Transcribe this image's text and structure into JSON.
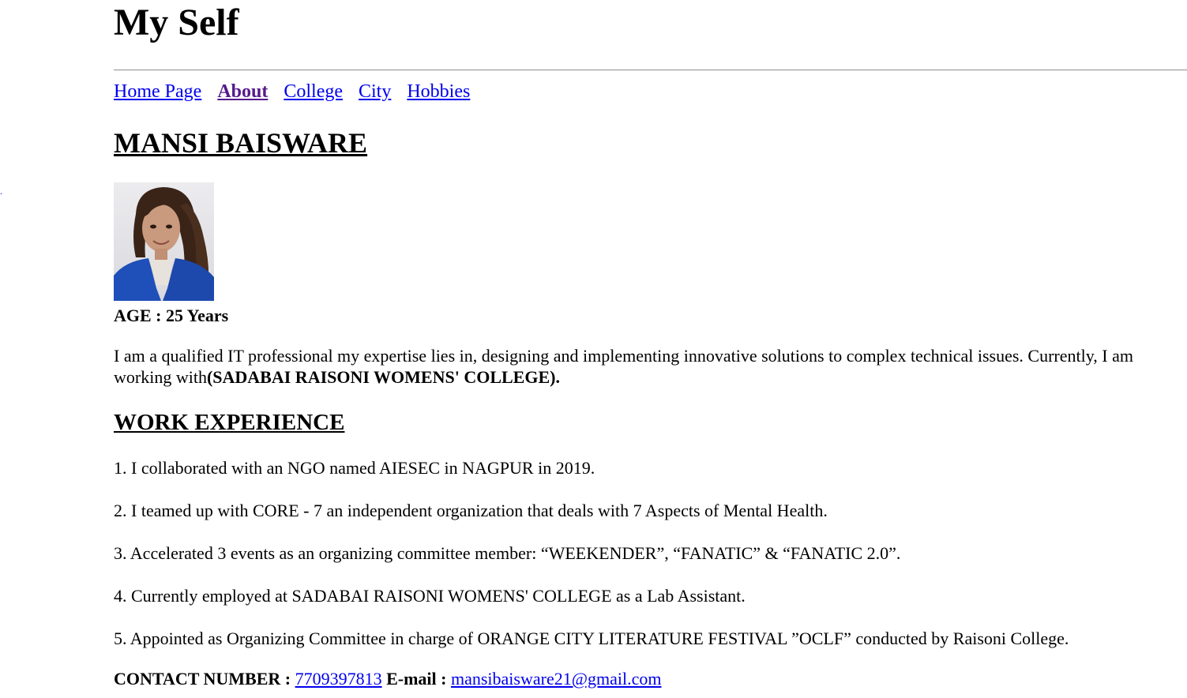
{
  "header": {
    "title": "My Self"
  },
  "nav": {
    "items": [
      {
        "label": "Home Page"
      },
      {
        "label": "About"
      },
      {
        "label": "College"
      },
      {
        "label": "City"
      },
      {
        "label": "Hobbies"
      }
    ],
    "active_index": 1
  },
  "profile": {
    "name": "MANSI BAISWARE",
    "photo_icon": "profile-photo",
    "age_label": "AGE : 25 Years",
    "intro_text": "I am a qualified IT professional my expertise lies in, designing and implementing innovative solutions to complex technical issues. Currently, I am working with",
    "intro_org": "(SADABAI RAISONI WOMENS' COLLEGE)."
  },
  "work": {
    "heading": "WORK EXPERIENCE",
    "items": [
      "1. I collaborated with an NGO named AIESEC in NAGPUR in 2019.",
      "2. I teamed up with CORE - 7 an independent organization that deals with 7 Aspects of Mental Health.",
      "3. Accelerated 3 events as an organizing committee member: “WEEKENDER”, “FANATIC” & “FANATIC 2.0”.",
      "4. Currently employed at SADABAI RAISONI WOMENS' COLLEGE as a Lab Assistant.",
      "5. Appointed as Organizing Committee in charge of ORANGE CITY LITERATURE FESTIVAL ”OCLF” conducted by Raisoni College."
    ]
  },
  "contact": {
    "phone_label": "CONTACT NUMBER :",
    "phone": "7709397813",
    "email_label": "E-mail :",
    "email": "mansibaisware21@gmail.com"
  },
  "colors": {
    "link": "#0000ee",
    "visited_link": "#551a8b",
    "text": "#000000",
    "background": "#ffffff"
  }
}
